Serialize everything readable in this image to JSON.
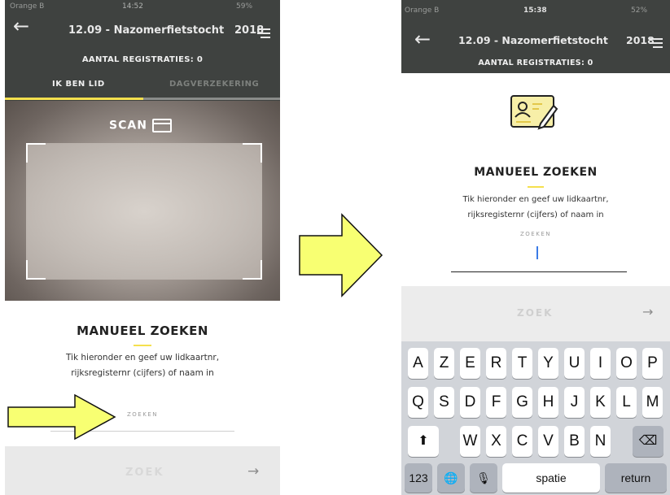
{
  "left": {
    "status": {
      "carrier": "Orange B",
      "time": "14:52",
      "battery": "59%"
    },
    "nav": {
      "title": "12.09 - Nazomerfietstocht",
      "year": "2018"
    },
    "registrations": "AANTAL REGISTRATIES: 0",
    "tabs": [
      "IK BEN LID",
      "DAGVERZEKERING"
    ],
    "scan_label": "SCAN",
    "manual": {
      "title": "MANUEEL ZOEKEN",
      "desc_line1": "Tik hieronder en geef uw lidkaartnr,",
      "desc_line2": "rijksregisternr (cijfers) of naam in",
      "field_label": "ZOEKEN"
    },
    "search_button": "ZOEK",
    "search_arrow": "→"
  },
  "right": {
    "status": {
      "carrier": "Orange B",
      "time": "15:38",
      "battery": "52%"
    },
    "nav": {
      "title": "12.09 - Nazomerfietstocht",
      "year": "2018"
    },
    "registrations": "AANTAL REGISTRATIES: 0",
    "manual": {
      "title": "MANUEEL ZOEKEN",
      "desc_line1": "Tik hieronder en geef uw lidkaartnr,",
      "desc_line2": "rijksregisternr (cijfers) of naam in",
      "field_label": "ZOEKEN"
    },
    "search_button": "ZOEK",
    "search_arrow": "→",
    "keyboard": {
      "row1": [
        "A",
        "Z",
        "E",
        "R",
        "T",
        "Y",
        "U",
        "I",
        "O",
        "P"
      ],
      "row2": [
        "Q",
        "S",
        "D",
        "F",
        "G",
        "H",
        "J",
        "K",
        "L",
        "M"
      ],
      "row3": [
        "W",
        "X",
        "C",
        "V",
        "B",
        "N"
      ],
      "shift": "⬆",
      "backspace": "⌫",
      "numbers": "123",
      "globe": "🌐",
      "mic": "🎙",
      "space": "spatie",
      "return": "return"
    }
  },
  "colors": {
    "header": "#3f4240",
    "accent": "#f5e04e",
    "arrow": "#f8ff72"
  }
}
